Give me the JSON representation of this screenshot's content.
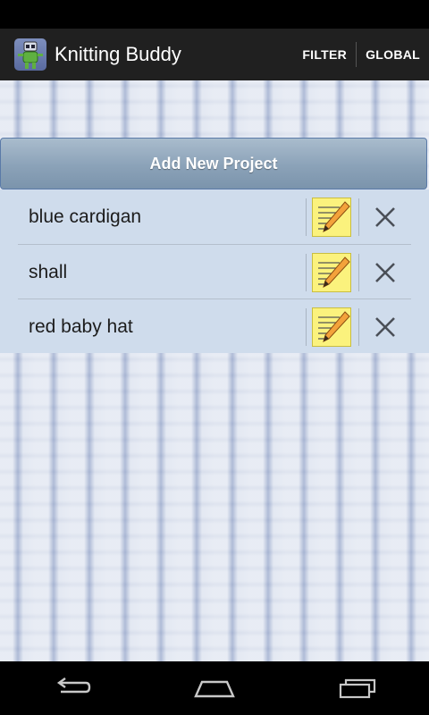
{
  "app": {
    "title": "Knitting Buddy",
    "icon": "knitting-robot-icon"
  },
  "action_bar": {
    "filter_label": "FILTER",
    "global_label": "GLOBAL"
  },
  "main": {
    "add_button_label": "Add New Project",
    "projects": [
      {
        "name": "blue cardigan",
        "edit_icon": "notepad-pencil-icon",
        "delete_icon": "close-icon"
      },
      {
        "name": "shall",
        "edit_icon": "notepad-pencil-icon",
        "delete_icon": "close-icon"
      },
      {
        "name": "red baby hat",
        "edit_icon": "notepad-pencil-icon",
        "delete_icon": "close-icon"
      }
    ]
  },
  "nav": {
    "back_icon": "back-icon",
    "home_icon": "home-icon",
    "recents_icon": "recents-icon"
  },
  "colors": {
    "action_bar_bg": "#202020",
    "list_bg": "#cfdcec",
    "button_bg": "#8ba2b8",
    "edit_icon_bg": "#fbf27d"
  }
}
